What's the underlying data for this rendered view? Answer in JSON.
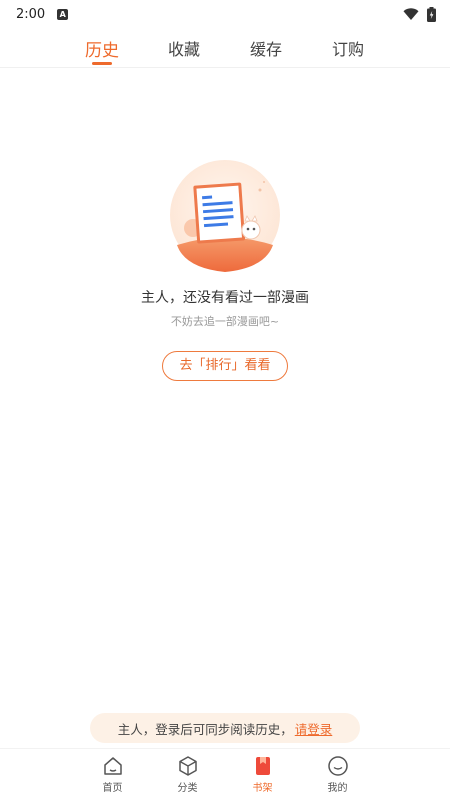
{
  "status_bar": {
    "time": "2:00",
    "notif_letter": "A"
  },
  "tabs": [
    {
      "label": "历史",
      "active": true
    },
    {
      "label": "收藏",
      "active": false
    },
    {
      "label": "缓存",
      "active": false
    },
    {
      "label": "订购",
      "active": false
    }
  ],
  "empty_state": {
    "title": "主人，还没有看过一部漫画",
    "subtitle": "不妨去追一部漫画吧~",
    "button_label": "去「排行」看看"
  },
  "login_banner": {
    "text": "主人，登录后可同步阅读历史，",
    "link": "请登录"
  },
  "bottom_nav": [
    {
      "label": "首页",
      "icon": "home-icon",
      "active": false
    },
    {
      "label": "分类",
      "icon": "category-icon",
      "active": false
    },
    {
      "label": "书架",
      "icon": "bookshelf-icon",
      "active": true
    },
    {
      "label": "我的",
      "icon": "profile-icon",
      "active": false
    }
  ],
  "colors": {
    "accent": "#ee6a2c",
    "banner_bg": "#fdf1e6"
  }
}
